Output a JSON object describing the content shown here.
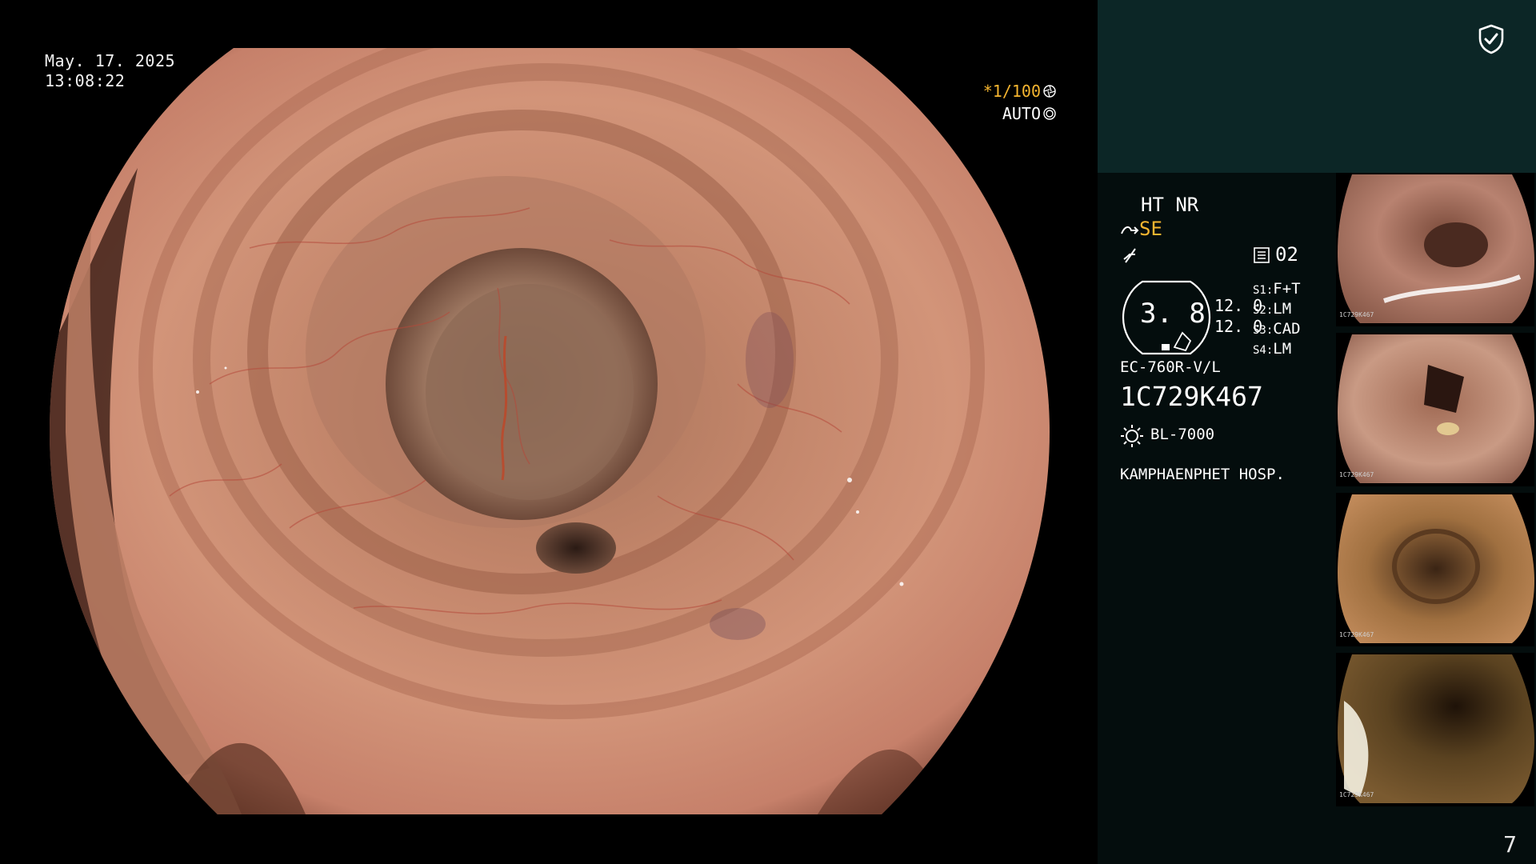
{
  "overlay": {
    "date": "May. 17. 2025",
    "time": "13:08:22",
    "shutter": "*1/100",
    "exposure": "AUTO"
  },
  "panel": {
    "mode_top": "HT NR",
    "mode_se": "SE",
    "memory_slot": "02",
    "gauge_value": "3. 8",
    "gain_values": [
      "12. 0",
      "12. 0"
    ],
    "settings": [
      {
        "key": "S1",
        "value": "F+T"
      },
      {
        "key": "S2",
        "value": "LM"
      },
      {
        "key": "S3",
        "value": "CAD"
      },
      {
        "key": "S4",
        "value": "LM"
      }
    ],
    "scope_model": "EC-760R-V/L",
    "scope_serial": "1C729K467",
    "light_source": "BL-7000",
    "hospital": "KAMPHAENPHET HOSP."
  },
  "thumbnails": [
    {
      "serial": "1C729K467"
    },
    {
      "serial": "1C729K467"
    },
    {
      "serial": "1C729K467"
    },
    {
      "serial": "1C729K467"
    }
  ],
  "page_number": "7",
  "icons": {
    "shield": "shield-check-icon",
    "light": "sun-icon",
    "memory": "memory-icon",
    "shutter_dial": "aperture-icon",
    "exposure_dial": "dial-icon",
    "scope": "scope-icon",
    "freeze": "lightning-icon"
  },
  "colors": {
    "panel_header": "#0c2626",
    "panel_bg": "#040d0d",
    "accent": "#f5b530"
  }
}
